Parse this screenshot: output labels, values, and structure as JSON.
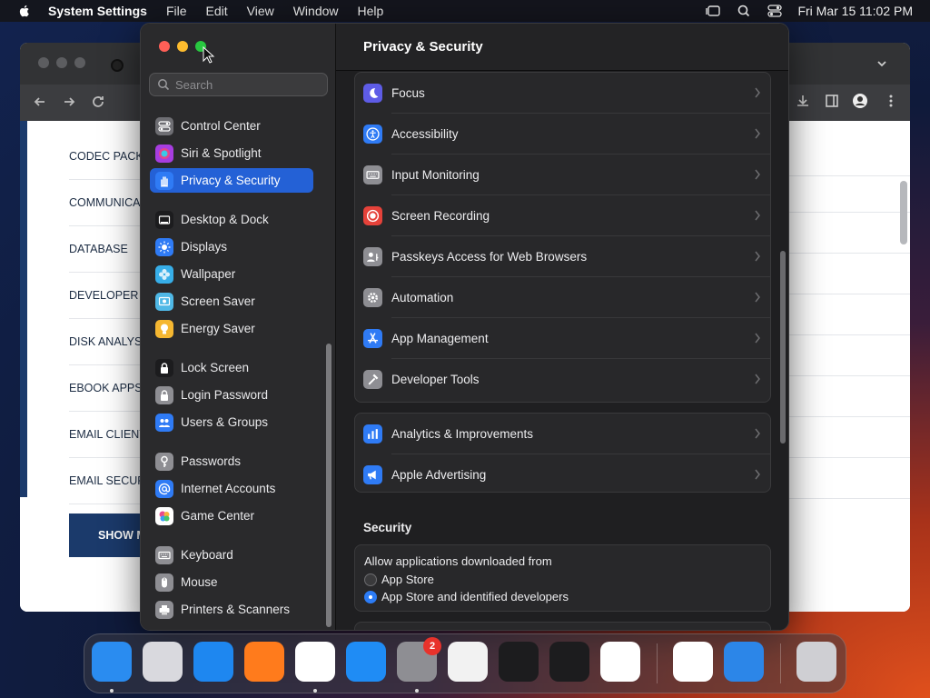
{
  "menubar": {
    "app_name": "System Settings",
    "items": [
      "File",
      "Edit",
      "View",
      "Window",
      "Help"
    ],
    "clock": "Fri Mar 15  11:02 PM"
  },
  "browser": {
    "categories": [
      "CODEC PACK",
      "COMMUNICA",
      "DATABASE",
      "DEVELOPER T",
      "DISK ANALYS",
      "EBOOK APPS",
      "EMAIL CLIENT",
      "EMAIL SECUR"
    ],
    "show_more": "SHOW M"
  },
  "settings": {
    "search_placeholder": "Search",
    "page_title": "Privacy & Security",
    "sidebar": [
      {
        "label": "Control Center",
        "icon": "control-center-icon",
        "color": "#6e6e73"
      },
      {
        "label": "Siri & Spotlight",
        "icon": "siri-icon",
        "color": "#a73de0"
      },
      {
        "label": "Privacy & Security",
        "icon": "hand-icon",
        "color": "#2f7bf5",
        "selected": true
      },
      {
        "label": "Desktop & Dock",
        "icon": "dock-icon",
        "color": "#1c1c1e"
      },
      {
        "label": "Displays",
        "icon": "sun-icon",
        "color": "#2f7bf5"
      },
      {
        "label": "Wallpaper",
        "icon": "flower-icon",
        "color": "#37aee8"
      },
      {
        "label": "Screen Saver",
        "icon": "screen-saver-icon",
        "color": "#4fb8e6"
      },
      {
        "label": "Energy Saver",
        "icon": "bulb-icon",
        "color": "#f5b731"
      },
      {
        "label": "Lock Screen",
        "icon": "lock-icon",
        "color": "#1c1c1e"
      },
      {
        "label": "Login Password",
        "icon": "login-lock-icon",
        "color": "#8e8e93"
      },
      {
        "label": "Users & Groups",
        "icon": "users-icon",
        "color": "#2f7bf5"
      },
      {
        "label": "Passwords",
        "icon": "key-icon",
        "color": "#8e8e93"
      },
      {
        "label": "Internet Accounts",
        "icon": "at-icon",
        "color": "#2f7bf5"
      },
      {
        "label": "Game Center",
        "icon": "game-center-icon",
        "color": "#ffffff"
      },
      {
        "label": "Keyboard",
        "icon": "keyboard-icon",
        "color": "#8e8e93"
      },
      {
        "label": "Mouse",
        "icon": "mouse-icon",
        "color": "#8e8e93"
      },
      {
        "label": "Printers & Scanners",
        "icon": "printer-icon",
        "color": "#8e8e93"
      }
    ],
    "rows_group1": [
      {
        "label": "Focus",
        "icon": "moon-icon",
        "color": "#5e5ce6"
      },
      {
        "label": "Accessibility",
        "icon": "accessibility-icon",
        "color": "#2f7bf5"
      },
      {
        "label": "Input Monitoring",
        "icon": "keyboard-icon",
        "color": "#8e8e93"
      },
      {
        "label": "Screen Recording",
        "icon": "record-icon",
        "color": "#e5423a"
      },
      {
        "label": "Passkeys Access for Web Browsers",
        "icon": "passkey-icon",
        "color": "#8e8e93"
      },
      {
        "label": "Automation",
        "icon": "gear-icon",
        "color": "#8e8e93"
      },
      {
        "label": "App Management",
        "icon": "app-store-icon",
        "color": "#2f7bf5"
      },
      {
        "label": "Developer Tools",
        "icon": "hammer-icon",
        "color": "#8e8e93"
      }
    ],
    "rows_group2": [
      {
        "label": "Analytics & Improvements",
        "icon": "chart-icon",
        "color": "#2f7bf5"
      },
      {
        "label": "Apple Advertising",
        "icon": "megaphone-icon",
        "color": "#2f7bf5"
      }
    ],
    "security": {
      "section_title": "Security",
      "allow_label": "Allow applications downloaded from",
      "options": [
        "App Store",
        "App Store and identified developers"
      ],
      "selected_option": "App Store and identified developers"
    }
  },
  "dock": {
    "apps": [
      {
        "name": "finder-icon",
        "color": "#2a8cf0"
      },
      {
        "name": "launchpad-icon",
        "color": "#d9d9de"
      },
      {
        "name": "safari-icon",
        "color": "#1e87f0"
      },
      {
        "name": "firefox-icon",
        "color": "#ff7b1c"
      },
      {
        "name": "chrome-icon",
        "color": "#ffffff"
      },
      {
        "name": "app-store-icon",
        "color": "#1f8cf5"
      },
      {
        "name": "system-settings-icon",
        "color": "#8e8e93"
      },
      {
        "name": "textedit-icon",
        "color": "#f2f2f2"
      },
      {
        "name": "terminal-icon",
        "color": "#1c1c1e"
      },
      {
        "name": "garageband-icon",
        "color": "#1c1c1e"
      },
      {
        "name": "vscode-icon",
        "color": "#ffffff"
      },
      {
        "name": "visual-studio-icon",
        "color": "#ffffff"
      },
      {
        "name": "weather-icon",
        "color": "#2c86e8"
      },
      {
        "name": "trash-icon",
        "color": "#cfcfd3"
      }
    ],
    "settings_badge": "2"
  }
}
